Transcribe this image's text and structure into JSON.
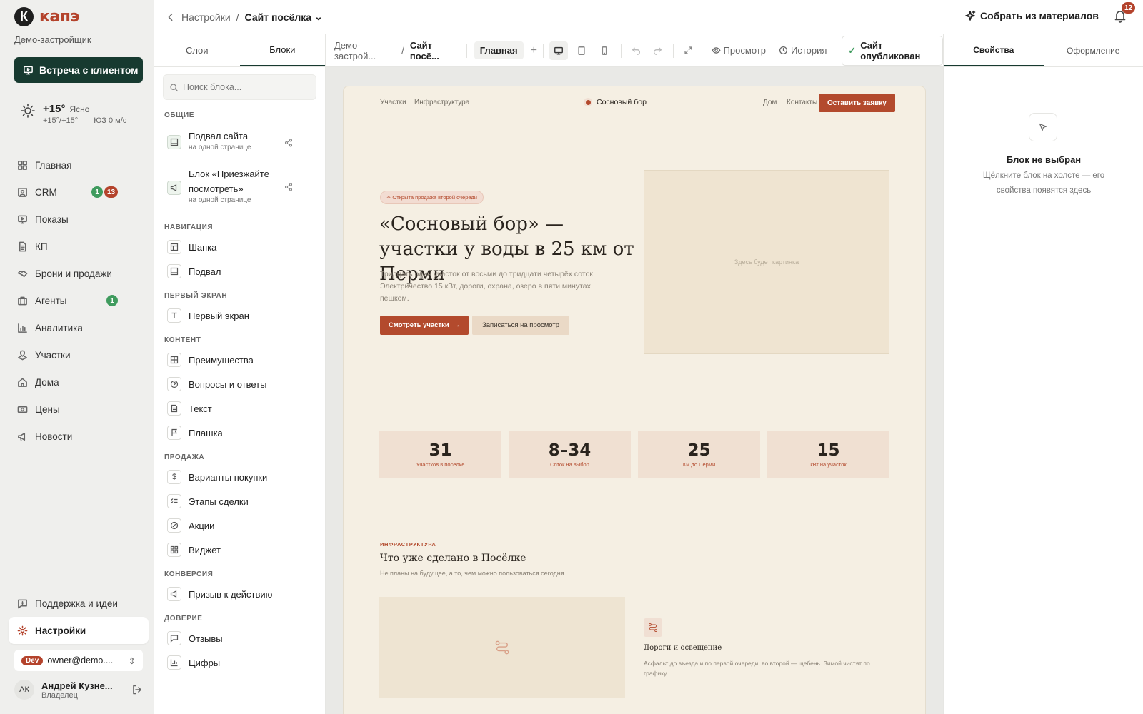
{
  "brand": {
    "logo_letter": "К",
    "name": "капэ",
    "company": "Демо-застройщик",
    "accent": "#b4432c",
    "dark": "#173a30"
  },
  "meet_button": "Встреча с клиентом",
  "weather": {
    "temp": "+15°",
    "condition": "Ясно",
    "range": "+15°/+15°",
    "wind": "ЮЗ 0 м/с"
  },
  "nav": [
    {
      "label": "Главная",
      "icon": "grid-icon"
    },
    {
      "label": "CRM",
      "icon": "user-card-icon",
      "badge_green": "1",
      "badge_red": "13"
    },
    {
      "label": "Показы",
      "icon": "monitor-icon"
    },
    {
      "label": "КП",
      "icon": "document-icon"
    },
    {
      "label": "Брони и продажи",
      "icon": "handshake-icon"
    },
    {
      "label": "Агенты",
      "icon": "briefcase-icon",
      "badge_green": "1"
    },
    {
      "label": "Аналитика",
      "icon": "bar-chart-icon"
    },
    {
      "label": "Участки",
      "icon": "map-pin-icon"
    },
    {
      "label": "Дома",
      "icon": "house-icon"
    },
    {
      "label": "Цены",
      "icon": "money-icon"
    },
    {
      "label": "Новости",
      "icon": "megaphone-icon"
    }
  ],
  "nav_bottom": [
    {
      "label": "Поддержка и идеи"
    },
    {
      "label": "Настройки"
    }
  ],
  "account": {
    "env": "Dev",
    "email": "owner@demo...."
  },
  "user": {
    "initials": "АК",
    "name": "Андрей Кузне...",
    "role": "Владелец"
  },
  "topbar": {
    "back": "Настройки",
    "current": "Сайт посёлка",
    "collect": "Собрать из материалов",
    "notifications": "12"
  },
  "left_panel": {
    "tabs": [
      "Слои",
      "Блоки"
    ],
    "search_placeholder": "Поиск блока...",
    "sections": {
      "general": {
        "title": "ОБЩИЕ",
        "items": [
          {
            "title": "Подвал сайта",
            "sub": "на одной странице"
          },
          {
            "title1": "Блок «Приезжайте",
            "title2": "посмотреть»",
            "sub": "на одной странице"
          }
        ]
      },
      "navigation": {
        "title": "НАВИГАЦИЯ",
        "items": [
          "Шапка",
          "Подвал"
        ]
      },
      "first": {
        "title": "ПЕРВЫЙ ЭКРАН",
        "items": [
          "Первый экран"
        ]
      },
      "content": {
        "title": "КОНТЕНТ",
        "items": [
          "Преимущества",
          "Вопросы и ответы",
          "Текст",
          "Плашка"
        ]
      },
      "sale": {
        "title": "ПРОДАЖА",
        "items": [
          "Варианты покупки",
          "Этапы сделки",
          "Акции",
          "Виджет"
        ]
      },
      "conversion": {
        "title": "КОНВЕРСИЯ",
        "items": [
          "Призыв к действию"
        ]
      },
      "trust": {
        "title": "ДОВЕРИЕ",
        "items": [
          "Отзывы",
          "Цифры"
        ]
      }
    }
  },
  "editor": {
    "crumb1": "Демо-застрой...",
    "crumb2": "Сайт посё...",
    "page": "Главная",
    "preview": "Просмотр",
    "history": "История",
    "published": "Сайт опубликован"
  },
  "right_panel": {
    "tabs": [
      "Свойства",
      "Оформление"
    ],
    "empty_title": "Блок не выбран",
    "empty_desc": "Щёлкните блок на холсте — его свойства появятся здесь"
  },
  "site": {
    "nav_left": [
      "Участки",
      "Инфраструктура"
    ],
    "brand": "Сосновый бор",
    "nav_right": [
      "Дом",
      "Контакты"
    ],
    "cta": "Оставить заявку",
    "tag": "Открыта продажа второй очереди",
    "title": "«Сосновый бор» — участки у воды в 25 км от Перми",
    "desc": "Тридцать один участок от восьми до тридцати четырёх соток. Электричество 15 кВт, дороги, охрана, озеро в пяти минутах пешком.",
    "btn_primary": "Смотреть участки",
    "btn_secondary": "Записаться на просмотр",
    "image_placeholder": "Здесь будет картинка",
    "stats": [
      {
        "value": "31",
        "label": "Участков в посёлке"
      },
      {
        "value": "8–34",
        "label": "Соток на выбор"
      },
      {
        "value": "25",
        "label": "Км до Перми"
      },
      {
        "value": "15",
        "label": "кВт на участок"
      }
    ],
    "infra": {
      "label": "ИНФРАСТРУКТУРА",
      "title": "Что уже сделано в Посёлке",
      "subtitle": "Не планы на будущее, а то, чем можно пользоваться сегодня",
      "feature_title": "Дороги и освещение",
      "feature_desc": "Асфальт до въезда и по первой очереди, во второй — щебень. Зимой чистят по графику."
    }
  }
}
